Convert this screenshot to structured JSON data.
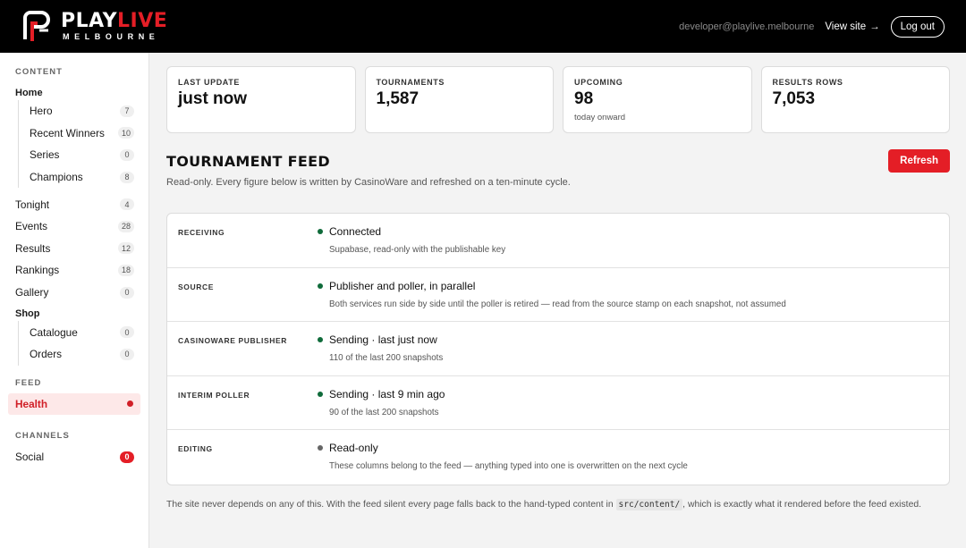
{
  "header": {
    "logo_word_play": "PLAY",
    "logo_word_live": "LIVE",
    "logo_sub": "MELBOURNE",
    "user_email": "developer@playlive.melbourne",
    "view_site_label": "View site",
    "view_site_arrow": "→",
    "logout_label": "Log out"
  },
  "sidebar": {
    "content_heading": "Content",
    "home_label": "Home",
    "home_items": [
      {
        "label": "Hero",
        "count": "7"
      },
      {
        "label": "Recent Winners",
        "count": "10"
      },
      {
        "label": "Series",
        "count": "0"
      },
      {
        "label": "Champions",
        "count": "8"
      }
    ],
    "top_items": [
      {
        "label": "Tonight",
        "count": "4"
      },
      {
        "label": "Events",
        "count": "28"
      },
      {
        "label": "Results",
        "count": "12"
      },
      {
        "label": "Rankings",
        "count": "18"
      },
      {
        "label": "Gallery",
        "count": "0"
      }
    ],
    "shop_label": "Shop",
    "shop_items": [
      {
        "label": "Catalogue",
        "count": "0"
      },
      {
        "label": "Orders",
        "count": "0"
      }
    ],
    "feed_heading": "Feed",
    "health_label": "Health",
    "channels_heading": "Channels",
    "social_label": "Social",
    "social_count": "0"
  },
  "stats": [
    {
      "label": "Last update",
      "value": "just now",
      "sub": ""
    },
    {
      "label": "Tournaments",
      "value": "1,587",
      "sub": ""
    },
    {
      "label": "Upcoming",
      "value": "98",
      "sub": "today onward"
    },
    {
      "label": "Results rows",
      "value": "7,053",
      "sub": ""
    }
  ],
  "feed": {
    "title": "TOURNAMENT FEED",
    "description": "Read-only. Every figure below is written by CasinoWare and refreshed on a ten-minute cycle.",
    "refresh_label": "Refresh",
    "rows": [
      {
        "label": "Receiving",
        "status": "Connected",
        "detail": "Supabase, read-only with the publishable key",
        "dot": "green"
      },
      {
        "label": "Source",
        "status": "Publisher and poller, in parallel",
        "detail": "Both services run side by side until the poller is retired — read from the source stamp on each snapshot, not assumed",
        "dot": "green"
      },
      {
        "label": "CasinoWare publisher",
        "status": "Sending · last just now",
        "detail": "110 of the last 200 snapshots",
        "dot": "green"
      },
      {
        "label": "Interim poller",
        "status": "Sending · last 9 min ago",
        "detail": "90 of the last 200 snapshots",
        "dot": "green"
      },
      {
        "label": "Editing",
        "status": "Read-only",
        "detail": "These columns belong to the feed — anything typed into one is overwritten on the next cycle",
        "dot": "gray"
      }
    ],
    "footnote_before": "The site never depends on any of this. With the feed silent every page falls back to the hand-typed content in ",
    "footnote_code": "src/content/",
    "footnote_after": ", which is exactly what it rendered before the feed existed."
  },
  "colors": {
    "brand_red": "#e41e26",
    "status_green": "#0f6b3a",
    "status_gray": "#666666"
  }
}
